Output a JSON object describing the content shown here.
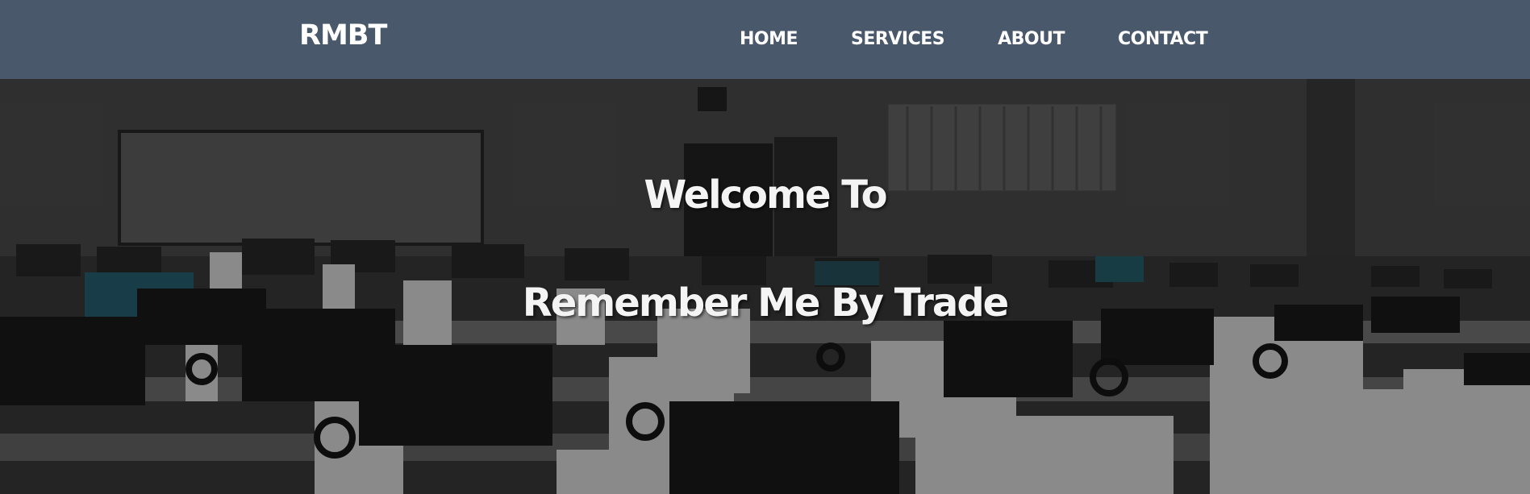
{
  "brand": {
    "logo": "RMBT"
  },
  "nav": {
    "items": [
      {
        "label": "HOME"
      },
      {
        "label": "SERVICES"
      },
      {
        "label": "ABOUT"
      },
      {
        "label": "CONTACT"
      }
    ]
  },
  "hero": {
    "line1": "Welcome To",
    "line2": "Remember Me By Trade",
    "image_subject": "computer-lab-with-headsets"
  },
  "colors": {
    "navbar": "#4a586c",
    "text": "#ffffff",
    "hero_base": "#2a2a2a"
  }
}
